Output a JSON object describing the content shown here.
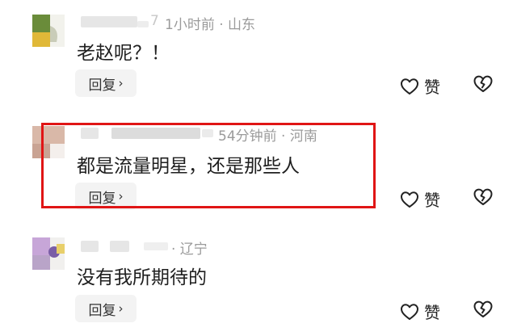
{
  "comments": [
    {
      "name_tail": "7",
      "meta": "1小时前 · 山东",
      "text": "老赵呢？！",
      "reply_label": "回复",
      "like_label": "赞"
    },
    {
      "meta": "54分钟前 · 河南",
      "text": "都是流量明星，还是那些人",
      "reply_label": "回复",
      "like_label": "赞"
    },
    {
      "meta": "· 辽宁",
      "text": "没有我所期待的",
      "reply_label": "回复",
      "like_label": "赞"
    }
  ],
  "icons": {
    "reply_chevron": "chevron-right-icon",
    "like": "heart-icon",
    "dislike": "broken-heart-icon"
  },
  "colors": {
    "highlight_border": "#e01515",
    "meta_text": "#9b9b9b",
    "reply_bg": "#f3f3f3"
  }
}
